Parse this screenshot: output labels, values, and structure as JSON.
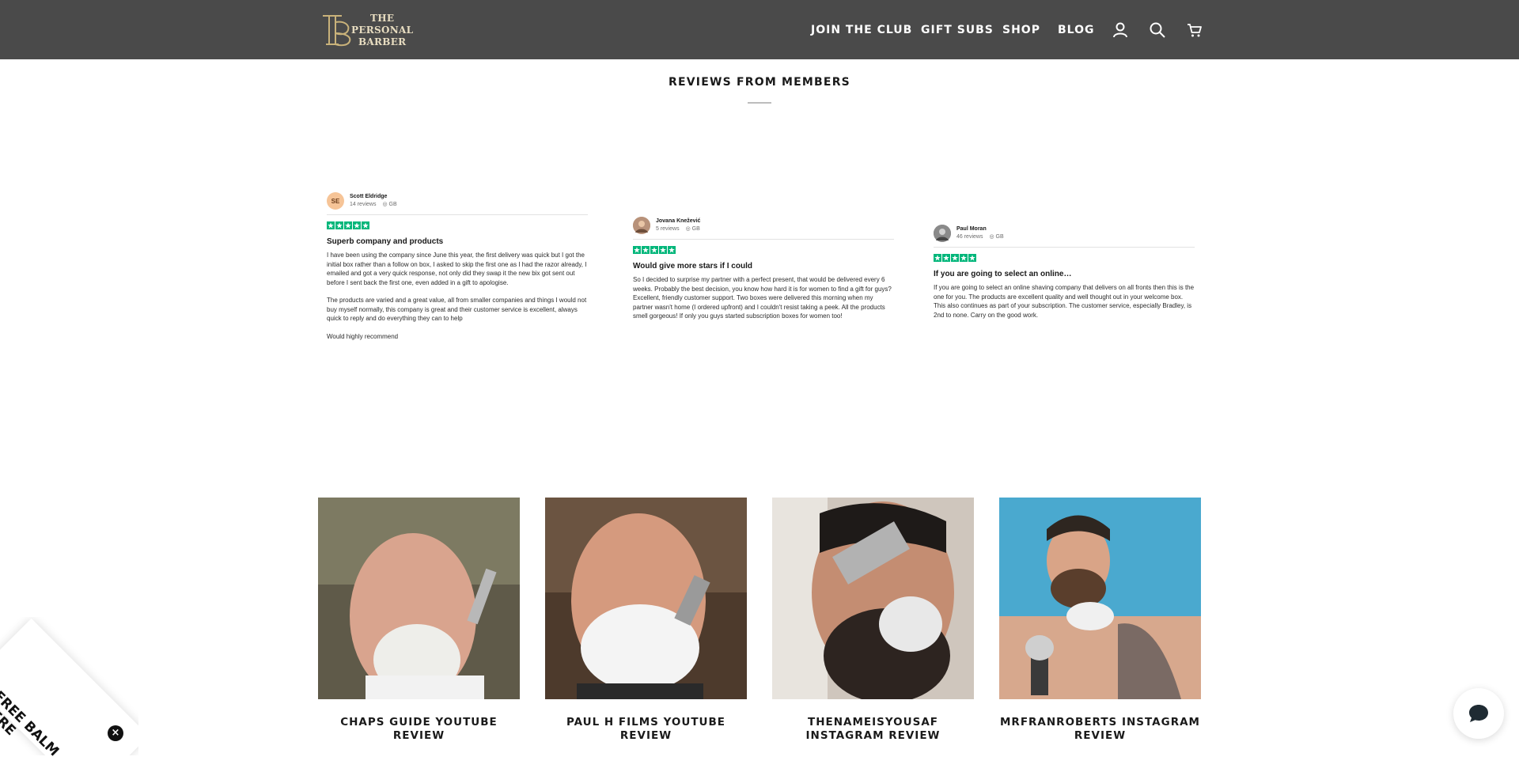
{
  "header": {
    "logo_lines": [
      "THE",
      "PERSONAL",
      "BARBER"
    ],
    "nav": [
      "JOIN THE CLUB",
      "GIFT SUBS",
      "SHOP",
      "BLOG"
    ],
    "icons": [
      "account-icon",
      "search-icon",
      "cart-icon"
    ]
  },
  "reviews_section": {
    "title": "REVIEWS FROM MEMBERS",
    "reviews": [
      {
        "initials": "SE",
        "name": "Scott Eldridge",
        "count": "14 reviews",
        "country": "GB",
        "rating": 5,
        "title": "Superb company and products",
        "body": [
          "I have been using the company since June this year, the first delivery was quick but I got the initial box rather than a follow on box, I asked to skip the first one as I had the razor already, I emailed and got a very quick response, not only did they swap it the new bix got sent out before I sent back the first one, even added in a gift to apologise.",
          "The products are varied and a great value, all from smaller companies and things I would not buy myself normally, this company is great and their customer service is excellent, always quick to reply and do everything they can to help",
          "Would highly recommend"
        ]
      },
      {
        "initials": "",
        "name": "Jovana Knežević",
        "count": "5 reviews",
        "country": "GB",
        "rating": 5,
        "title": "Would give more stars if I could",
        "body": [
          "So I decided to surprise my partner with a perfect present, that would be delivered every 6 weeks. Probably the best decision, you know how hard it is for women to find a gift for guys? Excellent, friendly customer support. Two boxes were delivered this morning when my partner wasn't home (I ordered upfront) and I couldn't resist taking a peek. All the products smell gorgeous! If only you guys started subscription boxes for women too!"
        ]
      },
      {
        "initials": "",
        "name": "Paul Moran",
        "count": "46 reviews",
        "country": "GB",
        "rating": 5,
        "title": "If you are going to select an online…",
        "body": [
          "If you are going to select an online shaving company that delivers on all fronts then this is the one for you. The products are excellent quality and well thought out in your welcome box. This also continues as part of your subscription. The customer service, especially Bradley, is 2nd to none. Carry on the good work."
        ]
      }
    ]
  },
  "video_reviews": [
    {
      "label": "CHAPS GUIDE YOUTUBE REVIEW"
    },
    {
      "label": "PAUL H FILMS YOUTUBE REVIEW"
    },
    {
      "label": "THENAMEISYOUSAF INSTAGRAM REVIEW"
    },
    {
      "label": "MRFRANROBERTS INSTAGRAM REVIEW"
    }
  ],
  "promo": {
    "text": "FREE BALM HERE",
    "close": "×"
  },
  "colors": {
    "header_bg": "#4a4a4a",
    "logo_gold": "#c9b27a",
    "trustpilot_green": "#00b67a"
  }
}
